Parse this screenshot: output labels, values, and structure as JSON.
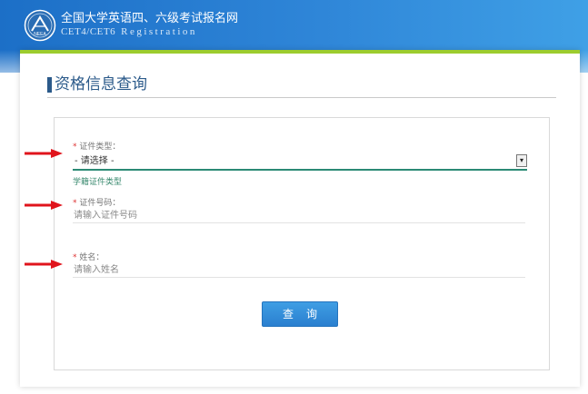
{
  "header": {
    "title": "全国大学英语四、六级考试报名网",
    "subtitle": "CET4/CET6",
    "subtitle_registration": "Registration",
    "logo_text": "NEEA"
  },
  "page": {
    "section_title": "资格信息查询"
  },
  "form": {
    "id_type": {
      "required_mark": "*",
      "label": "证件类型：",
      "value": "- 请选择 -",
      "dropdown_glyph": "▾",
      "hint": "学籍证件类型"
    },
    "id_number": {
      "required_mark": "*",
      "label": "证件号码：",
      "placeholder": "请输入证件号码"
    },
    "name": {
      "required_mark": "*",
      "label": "姓名：",
      "placeholder": "请输入姓名"
    },
    "submit_label": "查询"
  },
  "colors": {
    "header_blue": "#2f86d8",
    "accent_green": "#9ccc2e",
    "title_blue": "#2b5a8a",
    "button_blue": "#2a7fcf",
    "arrow_red": "#e0141c"
  }
}
